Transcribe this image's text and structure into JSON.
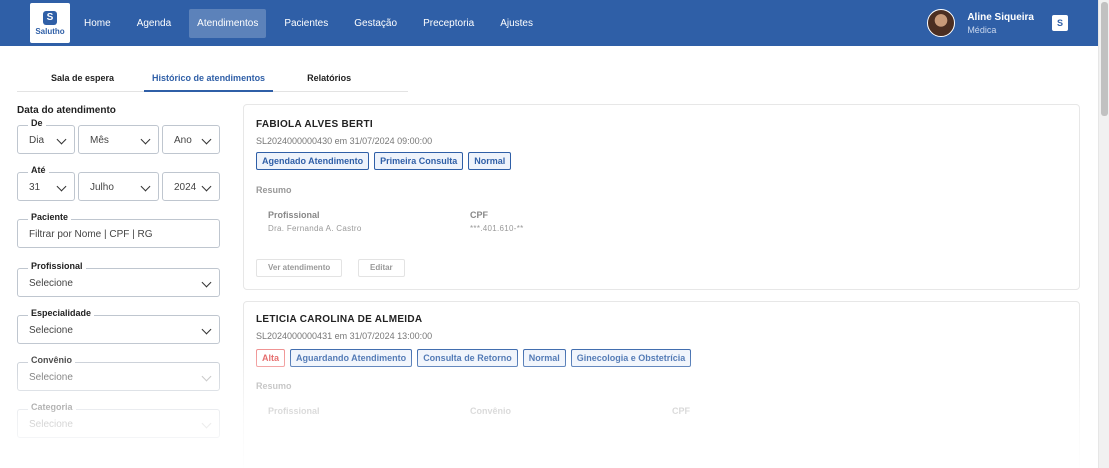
{
  "brand": {
    "logo_text": "Salutho"
  },
  "nav": {
    "items": [
      {
        "label": "Home"
      },
      {
        "label": "Agenda"
      },
      {
        "label": "Atendimentos"
      },
      {
        "label": "Pacientes"
      },
      {
        "label": "Gestação"
      },
      {
        "label": "Preceptoria"
      },
      {
        "label": "Ajustes"
      }
    ],
    "active_index": 2
  },
  "user": {
    "name": "Aline Siqueira",
    "role": "Médica"
  },
  "tabs": {
    "items": [
      {
        "label": "Sala de espera"
      },
      {
        "label": "Histórico de atendimentos"
      },
      {
        "label": "Relatórios"
      }
    ],
    "active_index": 1
  },
  "filters": {
    "title": "Data do atendimento",
    "de": {
      "label": "De",
      "day": "Dia",
      "month": "Mês",
      "year": "Ano"
    },
    "ate": {
      "label": "Até",
      "day": "31",
      "month": "Julho",
      "year": "2024"
    },
    "paciente": {
      "label": "Paciente",
      "placeholder": "Filtrar por Nome | CPF | RG"
    },
    "profissional": {
      "label": "Profissional",
      "value": "Selecione"
    },
    "especialidade": {
      "label": "Especialidade",
      "value": "Selecione"
    },
    "convenio": {
      "label": "Convênio",
      "value": "Selecione"
    },
    "categoria": {
      "label": "Categoria",
      "value": "Selecione"
    }
  },
  "cards": [
    {
      "name": "FABIOLA ALVES BERTI",
      "id_line": "SL2024000000430 em 31/07/2024 09:00:00",
      "badges": [
        "Agendado Atendimento",
        "Primeira Consulta",
        "Normal"
      ],
      "resumo_label": "Resumo",
      "profissional_label": "Profissional",
      "profissional_value": "Dra. Fernanda A. Castro",
      "cpf_label": "CPF",
      "cpf_value": "***.401.610-**",
      "btn_ver": "Ver atendimento",
      "btn_editar": "Editar"
    },
    {
      "name": "LETICIA CAROLINA DE ALMEIDA",
      "id_line": "SL2024000000431 em 31/07/2024 13:00:00",
      "badges": [
        "Alta",
        "Aguardando Atendimento",
        "Consulta de Retorno",
        "Normal",
        "Ginecologia e Obstetrícia"
      ],
      "resumo_label": "Resumo",
      "profissional_label": "Profissional",
      "convenio_label": "Convênio",
      "cpf_label": "CPF"
    }
  ],
  "colors": {
    "primary": "#2f5fa7",
    "alert": "#e05050"
  }
}
